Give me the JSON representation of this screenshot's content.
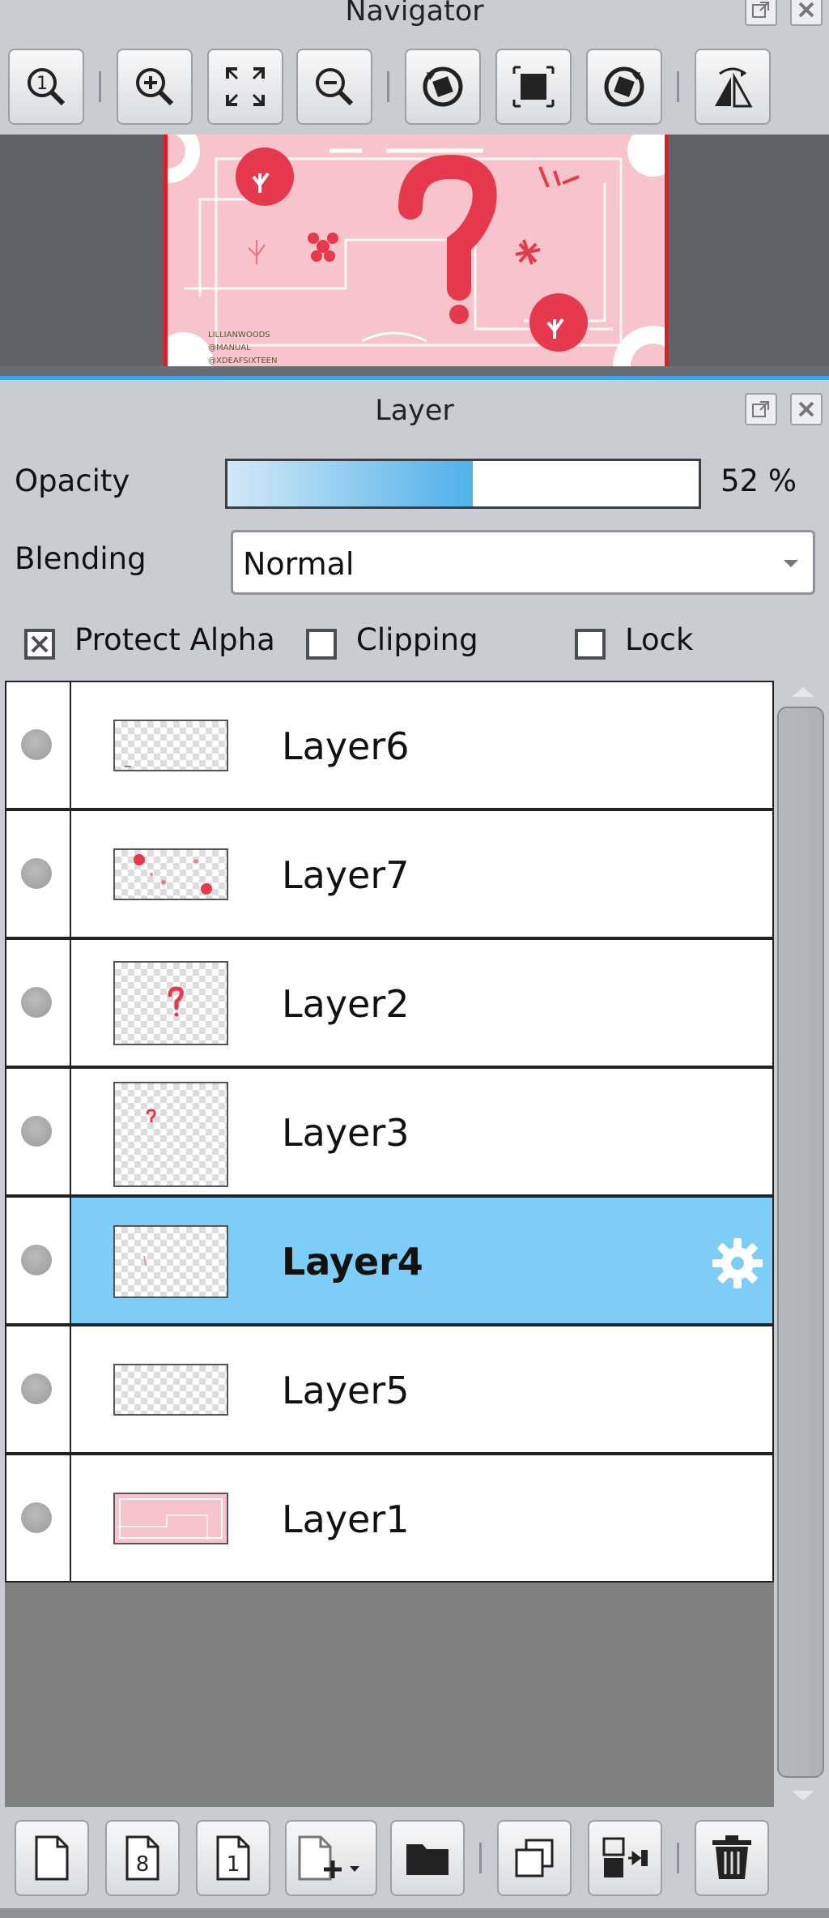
{
  "navigator": {
    "title": "Navigator",
    "toolbar": [
      {
        "name": "zoom-actual-icon",
        "tooltip": ""
      },
      {
        "name": "zoom-in-icon"
      },
      {
        "name": "fit-window-icon"
      },
      {
        "name": "zoom-out-icon"
      },
      {
        "name": "rotate-left-icon"
      },
      {
        "name": "reset-rotation-icon"
      },
      {
        "name": "rotate-right-icon"
      },
      {
        "name": "flip-horizontal-icon"
      }
    ],
    "preview_text": [
      "LILLIANWOODS",
      "@MANUAL",
      "@XDEAFSIXTEEN"
    ]
  },
  "layer_panel": {
    "title": "Layer",
    "opacity_label": "Opacity",
    "opacity_value": 52,
    "opacity_text": "52 %",
    "blending_label": "Blending",
    "blending_value": "Normal",
    "protect_alpha_label": "Protect Alpha",
    "protect_alpha_checked": true,
    "clipping_label": "Clipping",
    "clipping_checked": false,
    "lock_label": "Lock",
    "lock_checked": false,
    "layers": [
      {
        "name": "Layer6",
        "selected": false
      },
      {
        "name": "Layer7",
        "selected": false
      },
      {
        "name": "Layer2",
        "selected": false
      },
      {
        "name": "Layer3",
        "selected": false
      },
      {
        "name": "Layer4",
        "selected": true
      },
      {
        "name": "Layer5",
        "selected": false
      },
      {
        "name": "Layer1",
        "selected": false
      }
    ],
    "bottom_toolbar": {
      "new_layer": "new-layer-icon",
      "new_8bit_layer_label": "8",
      "new_1bit_layer_label": "1",
      "add_layer_menu": "add-layer-dropdown-icon",
      "new_folder": "folder-icon",
      "duplicate": "duplicate-layer-icon",
      "merge_down": "merge-down-icon",
      "delete": "trash-icon"
    },
    "colors": {
      "selected_row": "#7dcdf6",
      "opacity_fill": "#4fb1ea",
      "canvas_border": "#e01d25"
    }
  }
}
